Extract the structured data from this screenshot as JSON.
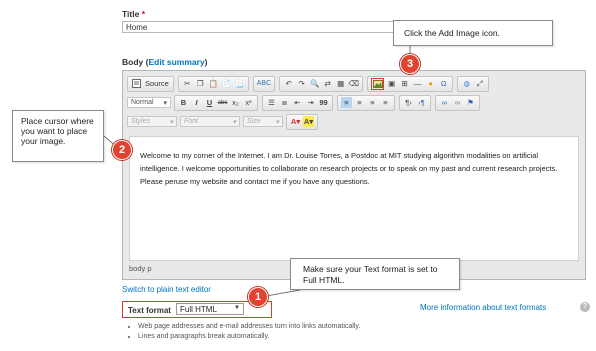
{
  "title_field": {
    "label": "Title",
    "required_mark": "*",
    "value": "Home"
  },
  "body_field": {
    "label": "Body",
    "edit_summary": "Edit summary"
  },
  "toolbar": {
    "source_label": "Source",
    "format_combo": "Normal",
    "styles_combo": "Styles",
    "font_combo": "Font",
    "size_combo": "Size",
    "bold": "B",
    "italic": "I",
    "underline": "U",
    "strike": "abc",
    "subscript": "x₂",
    "superscript": "x²",
    "blockquote": "99"
  },
  "editor": {
    "content": "Welcome to my corner of the Internet. I am Dr. Louise Torres, a Postdoc at MIT studying algorithm modalities on artificial intelligence. I welcome opportunities to collaborate on research projects or to speak on my past and current research projects. Please peruse my website and contact me if you have any questions.",
    "status_path": "body  p"
  },
  "switch_link": "Switch to plain text editor",
  "text_format": {
    "label": "Text format",
    "selected": "Full HTML",
    "more_info": "More information about text formats",
    "tips": [
      "Web page addresses and e-mail addresses turn into links automatically.",
      "Lines and paragraphs break automatically."
    ]
  },
  "annotations": {
    "callout_1": "Make sure your Text format is set to Full HTML.",
    "callout_2": "Place cursor where you want to place your image.",
    "callout_3": "Click the Add Image icon.",
    "marker_1": "1",
    "marker_2": "2",
    "marker_3": "3"
  },
  "colors": {
    "link": "#0074bd",
    "marker": "#e0432f",
    "required": "#e0001b"
  }
}
